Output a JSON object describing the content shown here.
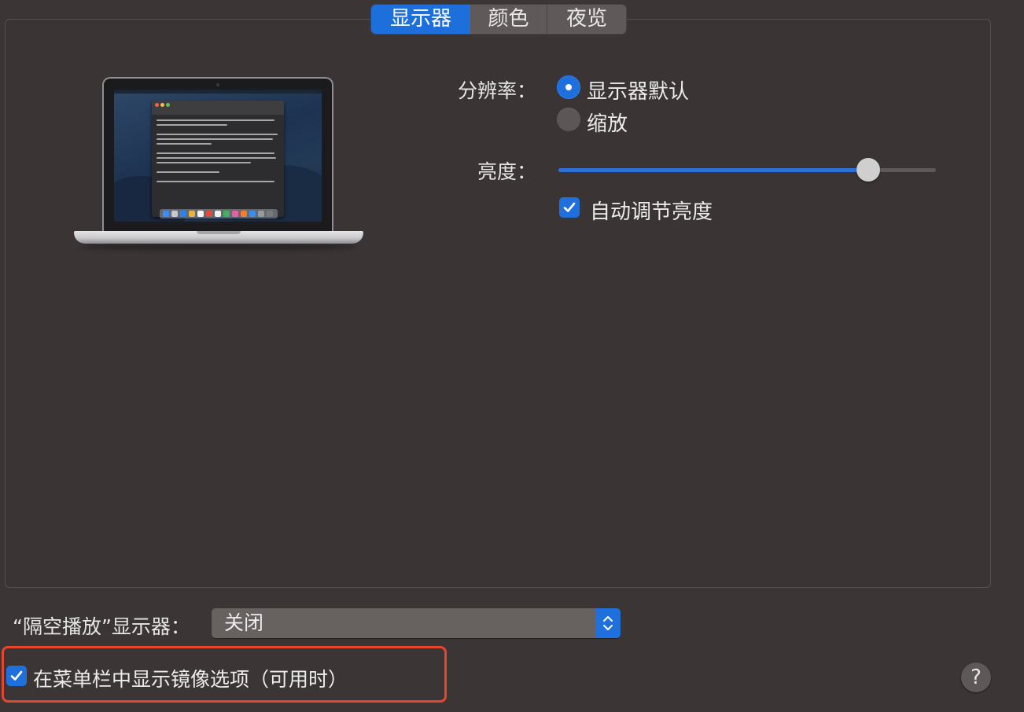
{
  "tabs": [
    {
      "label": "显示器",
      "selected": true
    },
    {
      "label": "颜色",
      "selected": false
    },
    {
      "label": "夜览",
      "selected": false
    }
  ],
  "resolution": {
    "label": "分辨率：",
    "options": [
      {
        "label": "显示器默认",
        "selected": true
      },
      {
        "label": "缩放",
        "selected": false
      }
    ]
  },
  "brightness": {
    "label": "亮度：",
    "value_fraction": 0.82,
    "auto_label": "自动调节亮度",
    "auto_checked": true
  },
  "airplay": {
    "label": "“隔空播放”显示器：",
    "selected": "关闭"
  },
  "mirror_option": {
    "label": "在菜单栏中显示镜像选项（可用时）",
    "checked": true
  },
  "help": {
    "label": "?"
  },
  "colors": {
    "accent": "#1f6fdd",
    "highlight_border": "#e8452c",
    "background": "#3b3535"
  },
  "icons": {
    "checkmark": "checkmark-icon",
    "updown": "chevron-updown-icon",
    "laptop": "laptop-display-icon"
  }
}
